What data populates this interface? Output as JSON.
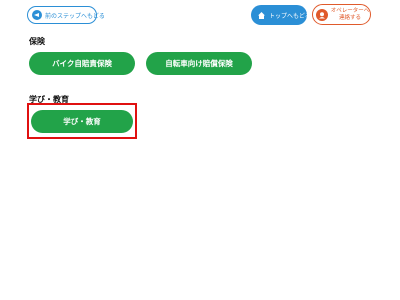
{
  "header": {
    "back_label": "前のステップへもどる",
    "top_label": "トップへもどる",
    "operator_label_line1": "オペレーターへ",
    "operator_label_line2": "連絡する"
  },
  "sections": [
    {
      "title": "保険",
      "buttons": [
        "バイク自賠責保険",
        "自転車向け賠償保険"
      ]
    },
    {
      "title": "学び・教育",
      "buttons": [
        "学び・教育"
      ]
    }
  ],
  "colors": {
    "primary_blue": "#2b8fd6",
    "operator_orange": "#e05a2b",
    "button_green": "#22a349",
    "highlight_red": "#e01010"
  }
}
